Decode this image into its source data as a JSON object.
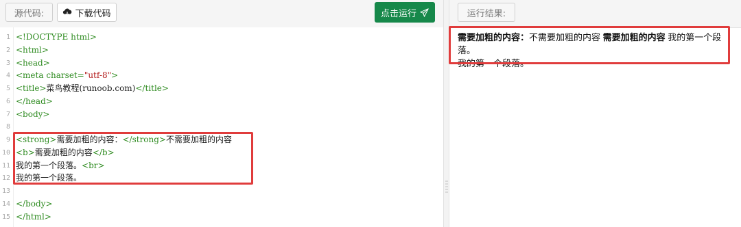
{
  "toolbar": {
    "source_label": "源代码:",
    "download_label": "下载代码",
    "run_label": "点击运行"
  },
  "editor": {
    "lines": [
      {
        "num": "1",
        "text": "<!DOCTYPE html>"
      },
      {
        "num": "2",
        "text": "<html>"
      },
      {
        "num": "3",
        "text": "<head>"
      },
      {
        "num": "4",
        "text": "<meta charset=\"utf-8\">"
      },
      {
        "num": "5",
        "text": "<title>菜鸟教程(runoob.com)</title>"
      },
      {
        "num": "6",
        "text": "</head>"
      },
      {
        "num": "7",
        "text": "<body>"
      },
      {
        "num": "8",
        "text": ""
      },
      {
        "num": "9",
        "text": "<strong>需要加粗的内容：</strong>不需要加粗的内容"
      },
      {
        "num": "10",
        "text": "<b>需要加粗的内容</b>"
      },
      {
        "num": "11",
        "text": "我的第一个段落。<br>"
      },
      {
        "num": "12",
        "text": "我的第一个段落。"
      },
      {
        "num": "13",
        "text": ""
      },
      {
        "num": "14",
        "text": "</body>"
      },
      {
        "num": "15",
        "text": "</html>"
      }
    ]
  },
  "result": {
    "label": "运行结果:",
    "strong_text": "需要加粗的内容：",
    "normal_text": "不需要加粗的内容",
    "b_text": "需要加粗的内容",
    "para1": "我的第一个段落。",
    "para2": "我的第一个段落。"
  },
  "colors": {
    "run_button": "#16884a",
    "highlight_border": "#e03c3c",
    "tag_color": "#2e8b20",
    "string_color": "#b31b1b"
  }
}
